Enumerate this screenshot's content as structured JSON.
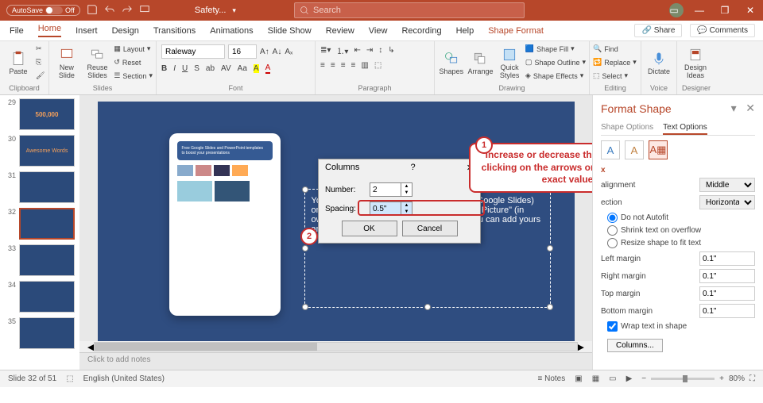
{
  "titlebar": {
    "autosave_label": "AutoSave",
    "autosave_state": "Off",
    "doc_title": "Safety...",
    "search_placeholder": "Search"
  },
  "tabs": {
    "items": [
      "File",
      "Home",
      "Insert",
      "Design",
      "Transitions",
      "Animations",
      "Slide Show",
      "Review",
      "View",
      "Recording",
      "Help",
      "Shape Format"
    ],
    "active": "Home",
    "share": "Share",
    "comments": "Comments"
  },
  "ribbon": {
    "clipboard": {
      "label": "Clipboard",
      "paste": "Paste"
    },
    "slides": {
      "label": "Slides",
      "new": "New\nSlide",
      "reuse": "Reuse\nSlides",
      "layout": "Layout",
      "reset": "Reset",
      "section": "Section"
    },
    "font": {
      "label": "Font",
      "name": "Raleway",
      "size": "16"
    },
    "paragraph": {
      "label": "Paragraph"
    },
    "drawing": {
      "label": "Drawing",
      "shapes": "Shapes",
      "arrange": "Arrange",
      "quick": "Quick\nStyles",
      "fill": "Shape Fill",
      "outline": "Shape Outline",
      "effects": "Shape Effects"
    },
    "editing": {
      "label": "Editing",
      "find": "Find",
      "replace": "Replace",
      "select": "Select"
    },
    "voice": {
      "label": "Voice",
      "dictate": "Dictate"
    },
    "designer": {
      "label": "Designer",
      "ideas": "Design\nIdeas"
    }
  },
  "thumbs": {
    "start": 29,
    "items": [
      {
        "n": "29",
        "text": "500,000"
      },
      {
        "n": "30",
        "text": "Awesome Words"
      },
      {
        "n": "31",
        "text": ""
      },
      {
        "n": "32",
        "text": "",
        "selected": true
      },
      {
        "n": "33",
        "text": ""
      },
      {
        "n": "34",
        "text": ""
      },
      {
        "n": "35",
        "text": ""
      }
    ]
  },
  "slide": {
    "textbox": "You can replace the image* on the screen with your own work. Right-click on it and then choose \"Replace image\" (in Google Slides) or \"Change Picture\" (in PPT) so you can add yours"
  },
  "dialog": {
    "title": "Columns",
    "number_label": "Number:",
    "number": "2",
    "spacing_label": "Spacing:",
    "spacing": "0.5\"",
    "ok": "OK",
    "cancel": "Cancel"
  },
  "callout": {
    "num": "1",
    "text": "Increase or decrease the spacing by clicking on the arrows or typing in the exact value"
  },
  "badge2": "2",
  "notes": "Click to add notes",
  "formatpane": {
    "title": "Format Shape",
    "tab1": "Shape Options",
    "tab2": "Text Options",
    "valign_label": "alignment",
    "valign": "Middle",
    "direction_label": "ection",
    "direction": "Horizontal",
    "autofit1": "Do not Autofit",
    "autofit2": "Shrink text on overflow",
    "autofit3": "Resize shape to fit text",
    "lmargin": "Left margin",
    "rmargin": "Right margin",
    "tmargin": "Top margin",
    "bmargin": "Bottom margin",
    "mval": "0.1\"",
    "wrap": "Wrap text in shape",
    "columns_btn": "Columns..."
  },
  "status": {
    "slide": "Slide 32 of 51",
    "lang": "English (United States)",
    "notes": "Notes",
    "zoom": "80%"
  }
}
